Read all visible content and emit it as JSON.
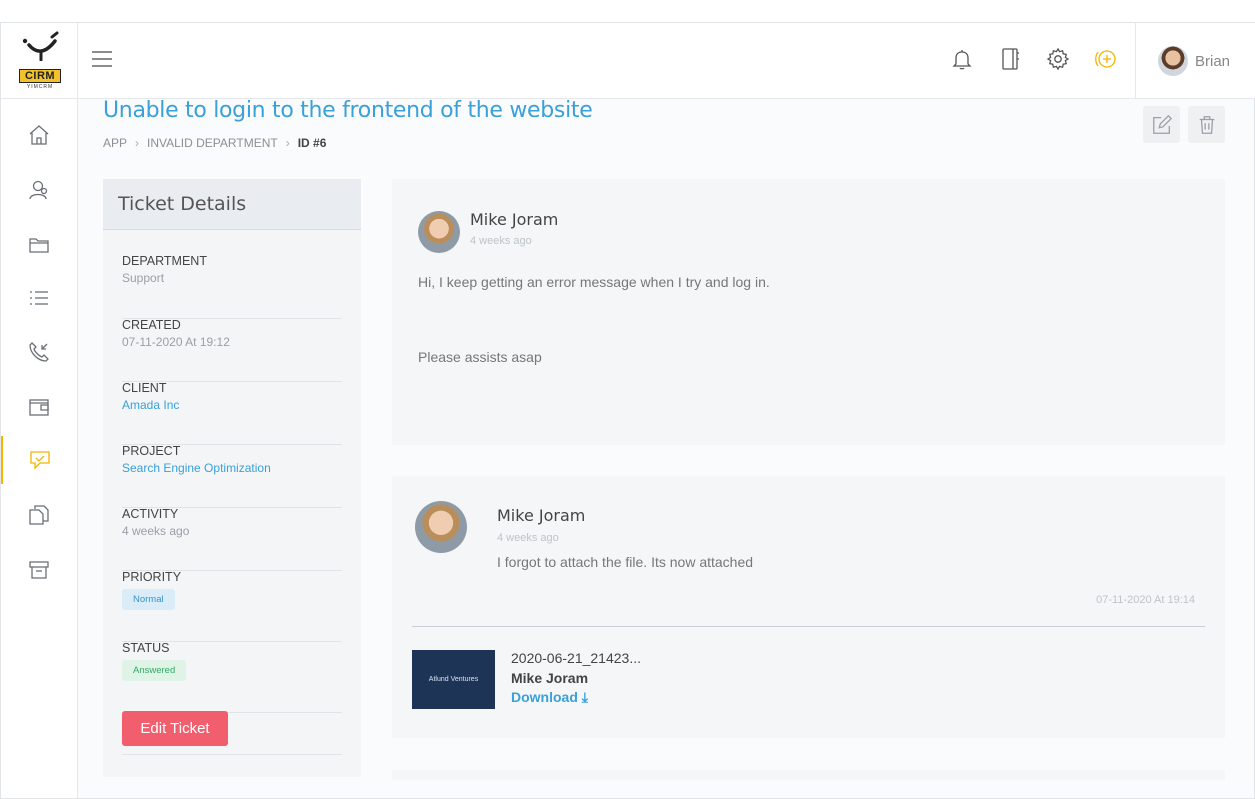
{
  "app": {
    "logo_text": "CIRM",
    "logo_subtext": "YIMCRM"
  },
  "topbar": {
    "icons": [
      "bell-icon",
      "notebook-icon",
      "gear-icon",
      "add-circle-icon"
    ],
    "user_name": "Brian"
  },
  "nav": {
    "items": [
      "home-icon",
      "contacts-icon",
      "folder-icon",
      "list-icon",
      "phone-icon",
      "wallet-icon",
      "chat-icon",
      "documents-icon",
      "archive-icon"
    ],
    "active": "chat-icon",
    "accent": "#f4b400"
  },
  "page": {
    "title": "Unable to login to the frontend of the website",
    "breadcrumb": [
      "APP",
      "INVALID DEPARTMENT",
      "ID #6"
    ]
  },
  "details": {
    "heading": "Ticket Details",
    "department_label": "DEPARTMENT",
    "department_value": "Support",
    "created_label": "CREATED",
    "created_value": "07-11-2020 At 19:12",
    "client_label": "CLIENT",
    "client_value": "Amada Inc",
    "project_label": "PROJECT",
    "project_value": "Search Engine Optimization",
    "activity_label": "ACTIVITY",
    "activity_value": "4 weeks ago",
    "priority_label": "PRIORITY",
    "priority_value": "Normal",
    "status_label": "STATUS",
    "status_value": "Answered",
    "edit_button": "Edit Ticket"
  },
  "messages": [
    {
      "author": "Mike Joram",
      "time": "4 weeks ago",
      "line1": "Hi, I keep getting an error message when I try and log in.",
      "line2": "Please assists asap"
    },
    {
      "author": "Mike Joram",
      "time": "4 weeks ago",
      "text": "I forgot to attach the file. Its now attached",
      "stamp": "07-11-2020 At 19:14",
      "attachment": {
        "thumb_text": "Atlund Ventures",
        "file_name": "2020-06-21_21423...",
        "author": "Mike Joram",
        "download_label": "Download"
      }
    }
  ],
  "colors": {
    "title_blue": "#3aa0d8",
    "edit_button": "#f15e6e",
    "accent_yellow": "#f4b400"
  }
}
